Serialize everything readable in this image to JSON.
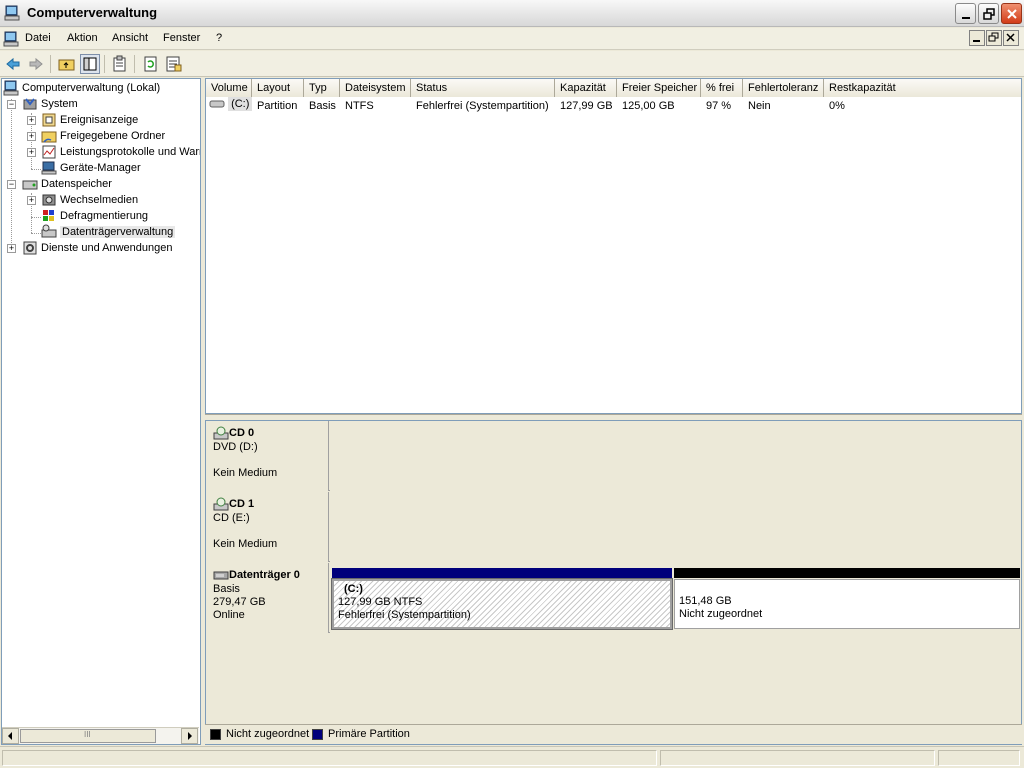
{
  "window": {
    "title": "Computerverwaltung"
  },
  "menu": {
    "items": [
      "Datei",
      "Aktion",
      "Ansicht",
      "Fenster",
      "?"
    ]
  },
  "tree": {
    "root": "Computerverwaltung (Lokal)",
    "system": "System",
    "system_children": [
      "Ereignisanzeige",
      "Freigegebene Ordner",
      "Leistungsprotokolle und Warn",
      "Geräte-Manager"
    ],
    "storage": "Datenspeicher",
    "storage_children": [
      "Wechselmedien",
      "Defragmentierung",
      "Datenträgerverwaltung"
    ],
    "services": "Dienste und Anwendungen",
    "scroll_thumb": "III"
  },
  "volume_list": {
    "columns": [
      "Volume",
      "Layout",
      "Typ",
      "Dateisystem",
      "Status",
      "Kapazität",
      "Freier Speicher",
      "% frei",
      "Fehlertoleranz",
      "Restkapazität"
    ],
    "rows": [
      {
        "volume": "(C:)",
        "layout": "Partition",
        "typ": "Basis",
        "dateisystem": "NTFS",
        "status": "Fehlerfrei (Systempartition)",
        "kapazitaet": "127,99 GB",
        "frei": "125,00 GB",
        "prozent_frei": "97 %",
        "fehlertoleranz": "Nein",
        "restkapazitaet": "0%"
      }
    ]
  },
  "disks": [
    {
      "name": "CD 0",
      "line1": "DVD (D:)",
      "line2": "",
      "line3": "Kein Medium"
    },
    {
      "name": "CD 1",
      "line1": "CD (E:)",
      "line2": "",
      "line3": "Kein Medium"
    },
    {
      "name": "Datenträger 0",
      "line1": "Basis",
      "line2": "279,47 GB",
      "line3": "Online"
    }
  ],
  "partitions": {
    "c": {
      "label": "(C:)",
      "size": "127,99 GB NTFS",
      "status": "Fehlerfrei (Systempartition)",
      "color": "#00007b"
    },
    "unallocated": {
      "size": "151,48 GB",
      "status": "Nicht zugeordnet",
      "color": "#000000"
    }
  },
  "legend": {
    "unallocated": "Nicht zugeordnet",
    "primary": "Primäre Partition"
  }
}
